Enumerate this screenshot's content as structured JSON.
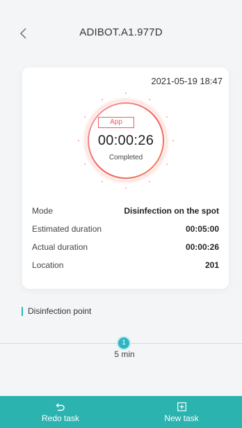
{
  "header": {
    "title": "ADIBOT.A1.977D",
    "back_icon": "chevron-left-icon"
  },
  "task": {
    "datetime": "2021-05-19 18:47",
    "source": "App",
    "elapsed": "00:00:26",
    "status": "Completed",
    "rows": [
      {
        "key": "Mode",
        "value": "Disinfection on the spot"
      },
      {
        "key": "Estimated duration",
        "value": "00:05:00"
      },
      {
        "key": "Actual duration",
        "value": "00:00:26"
      },
      {
        "key": "Location",
        "value": "201"
      }
    ]
  },
  "section": {
    "title": "Disinfection point"
  },
  "timeline": {
    "points": [
      {
        "number": "1",
        "label": "5 min"
      }
    ]
  },
  "actions": {
    "redo_label": "Redo task",
    "redo_icon": "undo-icon",
    "new_label": "New task",
    "new_icon": "plus-square-icon"
  },
  "colors": {
    "accent": "#2bb3af",
    "dial_red": "#ef5b5b",
    "timeline_point": "#2bb6c1"
  }
}
